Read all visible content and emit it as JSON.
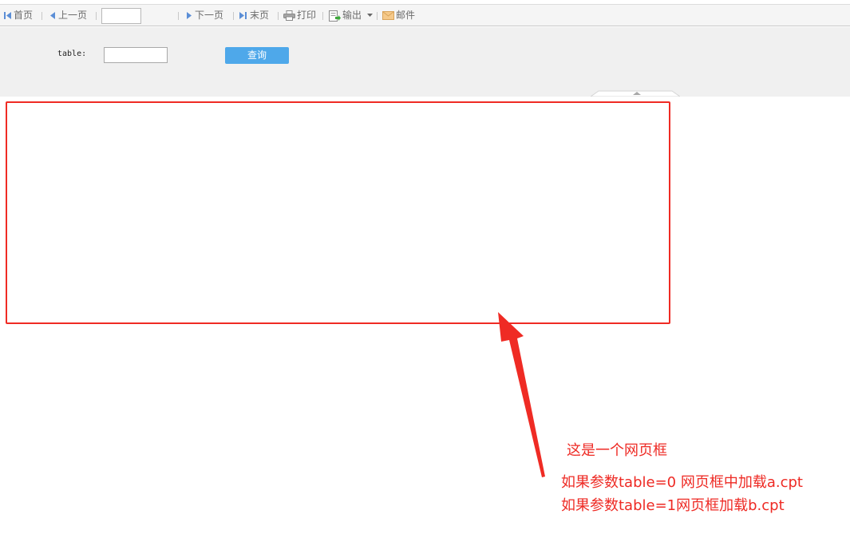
{
  "toolbar": {
    "first_label": "首页",
    "prev_label": "上一页",
    "page_value": "",
    "next_label": "下一页",
    "last_label": "末页",
    "print_label": "打印",
    "export_label": "输出",
    "email_label": "邮件"
  },
  "params": {
    "table_label": "table:",
    "table_value": "",
    "query_label": "查询"
  },
  "annotation": {
    "title": "这是一个网页框",
    "line1": "如果参数table=0 网页框中加载a.cpt",
    "line2": "如果参数table=1网页框加载b.cpt"
  },
  "colors": {
    "annotation_red": "#ee2a24",
    "query_blue": "#4ea8ea"
  },
  "icons": {
    "first": "first-page-icon",
    "prev": "prev-page-icon",
    "next": "next-page-icon",
    "last": "last-page-icon",
    "print": "print-icon",
    "export": "export-icon",
    "email": "email-icon"
  }
}
